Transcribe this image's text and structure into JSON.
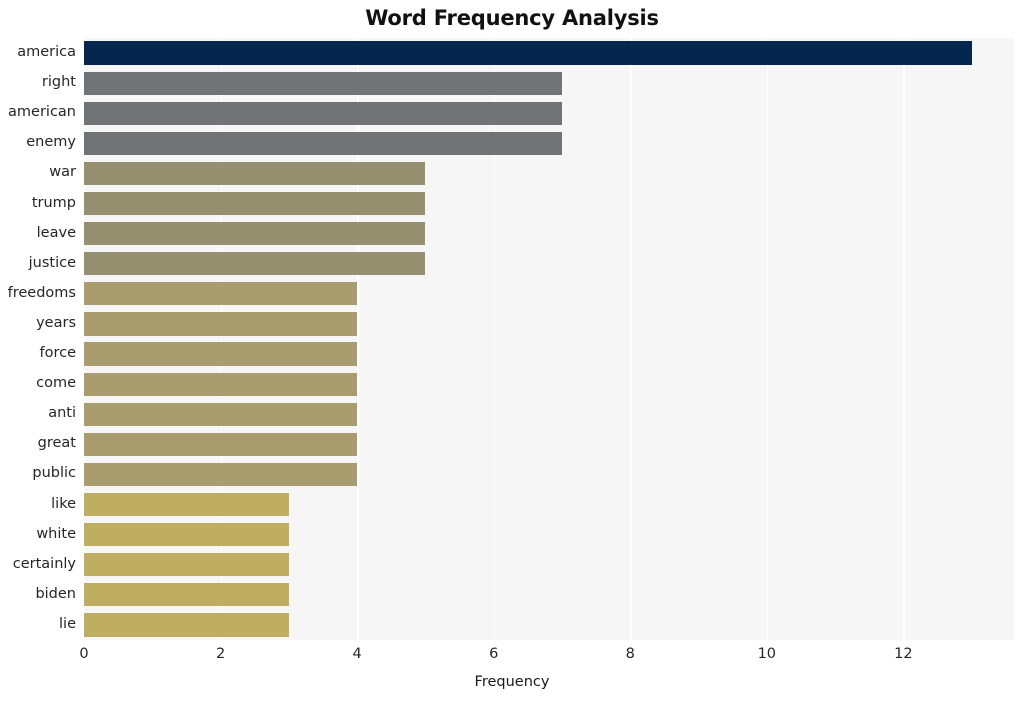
{
  "chart_data": {
    "type": "bar",
    "orientation": "horizontal",
    "title": "Word Frequency Analysis",
    "xlabel": "Frequency",
    "ylabel": "",
    "categories": [
      "america",
      "right",
      "american",
      "enemy",
      "war",
      "trump",
      "leave",
      "justice",
      "freedoms",
      "years",
      "force",
      "come",
      "anti",
      "great",
      "public",
      "like",
      "white",
      "certainly",
      "biden",
      "lie"
    ],
    "values": [
      13,
      7,
      7,
      7,
      5,
      5,
      5,
      5,
      4,
      4,
      4,
      4,
      4,
      4,
      4,
      3,
      3,
      3,
      3,
      3
    ],
    "colors": [
      "#04264f",
      "#727376",
      "#727376",
      "#727376",
      "#979070",
      "#979070",
      "#979070",
      "#979070",
      "#a99d6f",
      "#a99d6f",
      "#a99d6f",
      "#a99d6f",
      "#a99d6f",
      "#a99d6f",
      "#a99d6f",
      "#bfad62",
      "#bfad62",
      "#bfad62",
      "#bfad62",
      "#bfad62"
    ],
    "xlim": [
      0,
      13.62
    ],
    "xticks": [
      0,
      2,
      4,
      6,
      8,
      10,
      12
    ],
    "xtick_labels": [
      "0",
      "2",
      "4",
      "6",
      "8",
      "10",
      "12"
    ],
    "grid": true,
    "grid_axis": "x",
    "grid_color": "#ffffff",
    "plot_background": "#f6f6f7",
    "figure_background": "#ffffff",
    "legend": null
  }
}
